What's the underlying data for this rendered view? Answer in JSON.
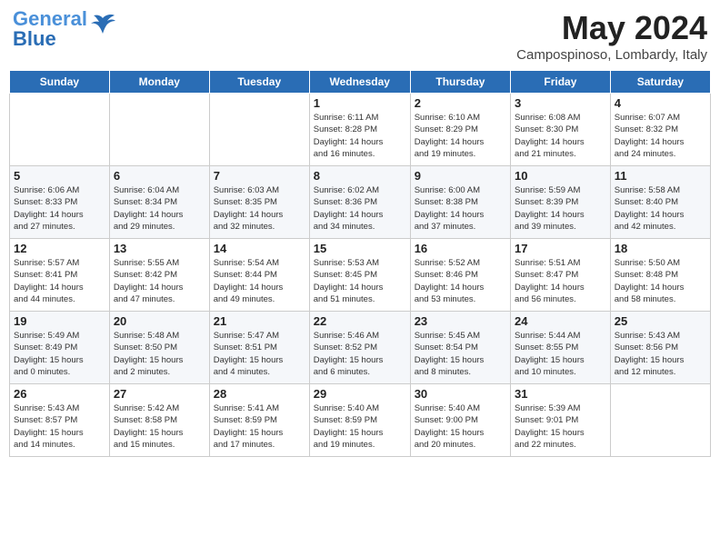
{
  "header": {
    "logo_line1": "General",
    "logo_line2": "Blue",
    "month": "May 2024",
    "location": "Campospinoso, Lombardy, Italy"
  },
  "weekdays": [
    "Sunday",
    "Monday",
    "Tuesday",
    "Wednesday",
    "Thursday",
    "Friday",
    "Saturday"
  ],
  "weeks": [
    [
      {
        "day": "",
        "info": ""
      },
      {
        "day": "",
        "info": ""
      },
      {
        "day": "",
        "info": ""
      },
      {
        "day": "1",
        "info": "Sunrise: 6:11 AM\nSunset: 8:28 PM\nDaylight: 14 hours\nand 16 minutes."
      },
      {
        "day": "2",
        "info": "Sunrise: 6:10 AM\nSunset: 8:29 PM\nDaylight: 14 hours\nand 19 minutes."
      },
      {
        "day": "3",
        "info": "Sunrise: 6:08 AM\nSunset: 8:30 PM\nDaylight: 14 hours\nand 21 minutes."
      },
      {
        "day": "4",
        "info": "Sunrise: 6:07 AM\nSunset: 8:32 PM\nDaylight: 14 hours\nand 24 minutes."
      }
    ],
    [
      {
        "day": "5",
        "info": "Sunrise: 6:06 AM\nSunset: 8:33 PM\nDaylight: 14 hours\nand 27 minutes."
      },
      {
        "day": "6",
        "info": "Sunrise: 6:04 AM\nSunset: 8:34 PM\nDaylight: 14 hours\nand 29 minutes."
      },
      {
        "day": "7",
        "info": "Sunrise: 6:03 AM\nSunset: 8:35 PM\nDaylight: 14 hours\nand 32 minutes."
      },
      {
        "day": "8",
        "info": "Sunrise: 6:02 AM\nSunset: 8:36 PM\nDaylight: 14 hours\nand 34 minutes."
      },
      {
        "day": "9",
        "info": "Sunrise: 6:00 AM\nSunset: 8:38 PM\nDaylight: 14 hours\nand 37 minutes."
      },
      {
        "day": "10",
        "info": "Sunrise: 5:59 AM\nSunset: 8:39 PM\nDaylight: 14 hours\nand 39 minutes."
      },
      {
        "day": "11",
        "info": "Sunrise: 5:58 AM\nSunset: 8:40 PM\nDaylight: 14 hours\nand 42 minutes."
      }
    ],
    [
      {
        "day": "12",
        "info": "Sunrise: 5:57 AM\nSunset: 8:41 PM\nDaylight: 14 hours\nand 44 minutes."
      },
      {
        "day": "13",
        "info": "Sunrise: 5:55 AM\nSunset: 8:42 PM\nDaylight: 14 hours\nand 47 minutes."
      },
      {
        "day": "14",
        "info": "Sunrise: 5:54 AM\nSunset: 8:44 PM\nDaylight: 14 hours\nand 49 minutes."
      },
      {
        "day": "15",
        "info": "Sunrise: 5:53 AM\nSunset: 8:45 PM\nDaylight: 14 hours\nand 51 minutes."
      },
      {
        "day": "16",
        "info": "Sunrise: 5:52 AM\nSunset: 8:46 PM\nDaylight: 14 hours\nand 53 minutes."
      },
      {
        "day": "17",
        "info": "Sunrise: 5:51 AM\nSunset: 8:47 PM\nDaylight: 14 hours\nand 56 minutes."
      },
      {
        "day": "18",
        "info": "Sunrise: 5:50 AM\nSunset: 8:48 PM\nDaylight: 14 hours\nand 58 minutes."
      }
    ],
    [
      {
        "day": "19",
        "info": "Sunrise: 5:49 AM\nSunset: 8:49 PM\nDaylight: 15 hours\nand 0 minutes."
      },
      {
        "day": "20",
        "info": "Sunrise: 5:48 AM\nSunset: 8:50 PM\nDaylight: 15 hours\nand 2 minutes."
      },
      {
        "day": "21",
        "info": "Sunrise: 5:47 AM\nSunset: 8:51 PM\nDaylight: 15 hours\nand 4 minutes."
      },
      {
        "day": "22",
        "info": "Sunrise: 5:46 AM\nSunset: 8:52 PM\nDaylight: 15 hours\nand 6 minutes."
      },
      {
        "day": "23",
        "info": "Sunrise: 5:45 AM\nSunset: 8:54 PM\nDaylight: 15 hours\nand 8 minutes."
      },
      {
        "day": "24",
        "info": "Sunrise: 5:44 AM\nSunset: 8:55 PM\nDaylight: 15 hours\nand 10 minutes."
      },
      {
        "day": "25",
        "info": "Sunrise: 5:43 AM\nSunset: 8:56 PM\nDaylight: 15 hours\nand 12 minutes."
      }
    ],
    [
      {
        "day": "26",
        "info": "Sunrise: 5:43 AM\nSunset: 8:57 PM\nDaylight: 15 hours\nand 14 minutes."
      },
      {
        "day": "27",
        "info": "Sunrise: 5:42 AM\nSunset: 8:58 PM\nDaylight: 15 hours\nand 15 minutes."
      },
      {
        "day": "28",
        "info": "Sunrise: 5:41 AM\nSunset: 8:59 PM\nDaylight: 15 hours\nand 17 minutes."
      },
      {
        "day": "29",
        "info": "Sunrise: 5:40 AM\nSunset: 8:59 PM\nDaylight: 15 hours\nand 19 minutes."
      },
      {
        "day": "30",
        "info": "Sunrise: 5:40 AM\nSunset: 9:00 PM\nDaylight: 15 hours\nand 20 minutes."
      },
      {
        "day": "31",
        "info": "Sunrise: 5:39 AM\nSunset: 9:01 PM\nDaylight: 15 hours\nand 22 minutes."
      },
      {
        "day": "",
        "info": ""
      }
    ]
  ]
}
